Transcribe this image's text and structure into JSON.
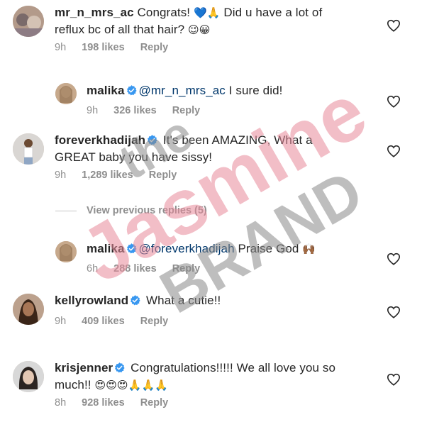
{
  "comments": [
    {
      "username": "mr_n_mrs_ac",
      "text_a": "Congrats! ",
      "emoji_a": "💙🙏",
      "text_b": " Did u have a lot of",
      "text_line2": "reflux bc of all that hair? ",
      "emoji_b": "😉😀",
      "time": "9h",
      "likes": "198 likes",
      "reply": "Reply"
    },
    {
      "username": "malika",
      "mention": "@mr_n_mrs_ac",
      "text": " I sure did!",
      "time": "9h",
      "likes": "326 likes",
      "reply": "Reply"
    },
    {
      "username": "foreverkhadijah",
      "text_line1": " It's been AMAZING, What a",
      "text_line2": "GREAT baby you have sissy!",
      "time": "9h",
      "likes": "1,289 likes",
      "reply": "Reply"
    },
    {
      "username": "malika",
      "mention": "@foreverkhadijah",
      "text": " Praise God ",
      "emoji": "🙌🏾",
      "time": "6h",
      "likes": "288 likes",
      "reply": "Reply"
    },
    {
      "username": "kellyrowland",
      "text": " What a cutie!!",
      "time": "9h",
      "likes": "409 likes",
      "reply": "Reply"
    },
    {
      "username": "krisjenner",
      "text_line1": " Congratulations!!!!! We all love you so",
      "text_line2": "much!! ",
      "emoji": "😍😍😍🙏🙏🙏",
      "time": "8h",
      "likes": "928 likes",
      "reply": "Reply"
    }
  ],
  "view_replies": "View previous replies (5)",
  "watermark": {
    "line1": "the",
    "line2": "Jasmine",
    "line3": "BRAND"
  },
  "icons": {
    "verified": "verified-badge-icon",
    "like": "heart-outline-icon"
  },
  "colors": {
    "verified_blue": "#3897f0",
    "mention": "#00376b",
    "meta_gray": "#8e8e8e",
    "watermark_pink": "#e88a9a",
    "watermark_gray": "#8a8a8a"
  }
}
